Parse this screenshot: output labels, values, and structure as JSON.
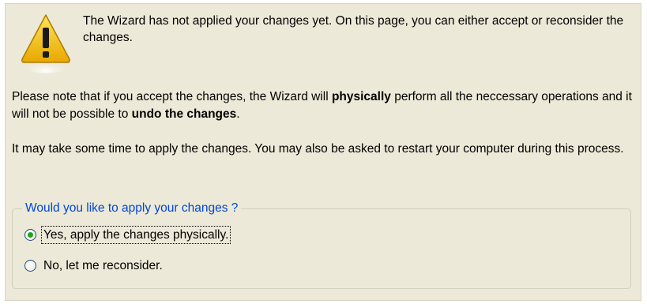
{
  "wizard": {
    "intro": "The Wizard has not applied your changes yet. On this page, you can either accept or reconsider the changes.",
    "note": {
      "before": "Please note that if you accept the changes, the Wizard will ",
      "bold1": "physically",
      "middle": " perform all the neccessary operations and it will not be possible to ",
      "bold2": "undo the changes",
      "after": "."
    },
    "time_note": "It may take some time to apply the changes. You may also be asked to restart your computer during this process.",
    "question": {
      "legend": "Would you like to apply your changes ?",
      "options": [
        {
          "label": "Yes, apply the changes physically.",
          "selected": true
        },
        {
          "label": "No, let me reconsider.",
          "selected": false
        }
      ]
    },
    "icon": "warning-icon",
    "colors": {
      "panel_bg": "#ECE9D8",
      "legend": "#0046D5",
      "radio_dot": "#21A121",
      "warning_yellow": "#F5C400"
    }
  }
}
